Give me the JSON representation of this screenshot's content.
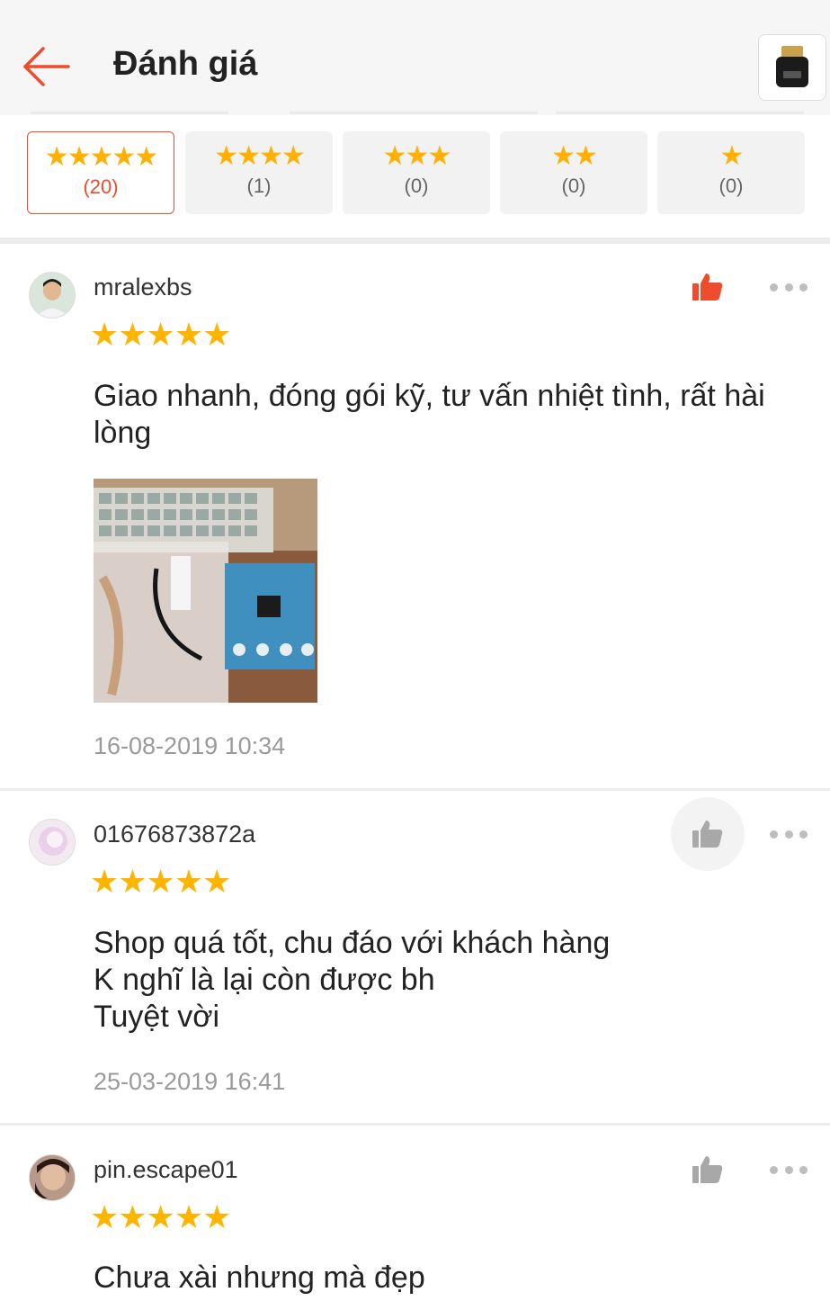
{
  "header": {
    "title": "Đánh giá",
    "back_icon": "arrow-left-icon",
    "product_thumb_icon": "usb-bluetooth-dongle-icon"
  },
  "filters": [
    {
      "stars": "★★★★★",
      "count": "(20)",
      "active": true
    },
    {
      "stars": "★★★★",
      "count": "(1)",
      "active": false
    },
    {
      "stars": "★★★",
      "count": "(0)",
      "active": false
    },
    {
      "stars": "★★",
      "count": "(0)",
      "active": false
    },
    {
      "stars": "★",
      "count": "(0)",
      "active": false
    }
  ],
  "reviews": [
    {
      "username": "mralexbs",
      "rating": 5,
      "stars": "★★★★★",
      "text": "Giao nhanh, đóng gói kỹ, tư vấn nhiệt tình, rất hài lòng",
      "has_photo": true,
      "date": "16-08-2019 10:34",
      "liked": true
    },
    {
      "username": "01676873872a",
      "rating": 5,
      "stars": "★★★★★",
      "text": "Shop quá tốt, chu đáo với khách hàng\nK nghĩ là lại còn được bh\nTuyệt vời",
      "has_photo": false,
      "date": "25-03-2019 16:41",
      "liked": false
    },
    {
      "username": "pin.escape01",
      "rating": 5,
      "stars": "★★★★★",
      "text": "Chưa xài nhưng mà đẹp",
      "has_photo": false,
      "date": "",
      "liked": false
    }
  ],
  "colors": {
    "accent": "#ee4d2d",
    "star": "#ffb400",
    "muted": "#9a9a9a"
  }
}
